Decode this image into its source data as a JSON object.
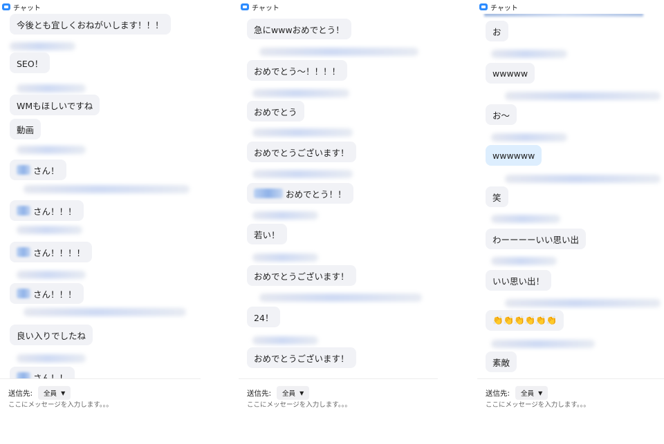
{
  "panels": [
    {
      "title": "チャット",
      "messages": [
        {
          "text": "今後とも宜しくおねがいします！！！"
        },
        {
          "text": "SEO！"
        },
        {
          "text": "WMもほしいですね"
        },
        {
          "text": "動画"
        },
        {
          "text": "さん！"
        },
        {
          "text": "さん！！！"
        },
        {
          "text": "さん！！！！"
        },
        {
          "text": "さん！！！"
        },
        {
          "text": "良い入りでしたね"
        },
        {
          "text": "さん！！"
        }
      ],
      "footer": {
        "recipient_label": "送信先:",
        "recipient_value": "全員",
        "input_placeholder": "ここにメッセージを入力します。。。"
      }
    },
    {
      "title": "チャット",
      "messages": [
        {
          "text": "急にwwwおめでとう！"
        },
        {
          "text": "おめでとう～！！！！"
        },
        {
          "text": "おめでとう"
        },
        {
          "text": "おめでとうございます！"
        },
        {
          "text": "おめでとう！！"
        },
        {
          "text": "若い！"
        },
        {
          "text": "おめでとうございます！"
        },
        {
          "text": "24！"
        },
        {
          "text": "おめでとうございます！"
        }
      ],
      "footer": {
        "recipient_label": "送信先:",
        "recipient_value": "全員",
        "input_placeholder": "ここにメッセージを入力します。。。"
      }
    },
    {
      "title": "チャット",
      "messages": [
        {
          "text": "お"
        },
        {
          "text": "wwwww"
        },
        {
          "text": "お～"
        },
        {
          "text": "wwwwww"
        },
        {
          "text": "笑"
        },
        {
          "text": "わーーーーいい思い出"
        },
        {
          "text": "いい思い出！"
        },
        {
          "text": "👏👏👏👏👏👏"
        },
        {
          "text": "素敵"
        }
      ],
      "footer": {
        "recipient_label": "送信先:",
        "recipient_value": "全員",
        "input_placeholder": "ここにメッセージを入力します。。。"
      }
    }
  ],
  "colors": {
    "accent": "#2d8cff",
    "bubble": "#f1f2f6",
    "bubble_self": "#ddeefe"
  },
  "icons": {
    "header": "chat-bubble-icon",
    "select": "chevron-down-icon"
  }
}
